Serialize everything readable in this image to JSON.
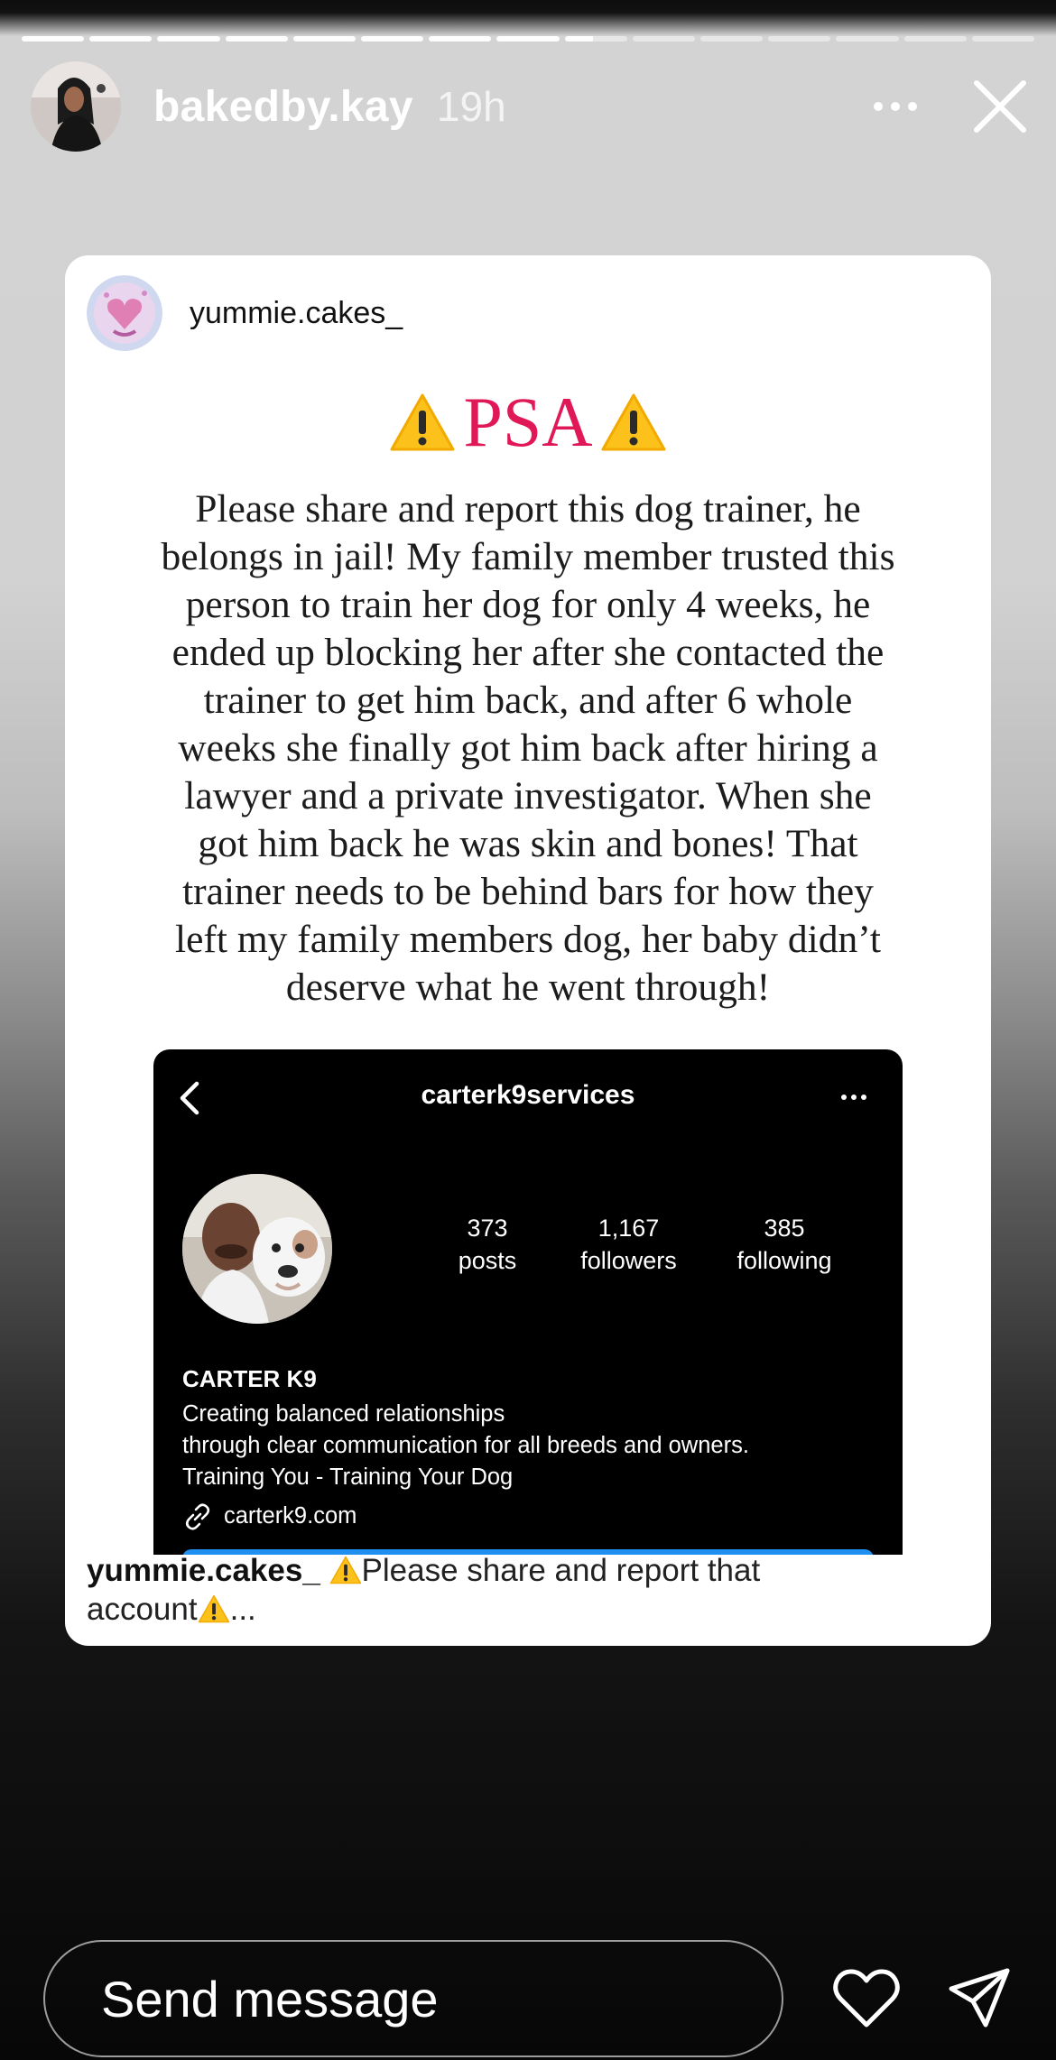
{
  "story": {
    "segments_total": 15,
    "segments_done": 8,
    "current_progress": 0.45
  },
  "header": {
    "username": "bakedby.kay",
    "time": "19h",
    "more_icon": "more-horizontal-icon",
    "close_icon": "close-icon"
  },
  "shared_post": {
    "username": "yummie.cakes_",
    "psa_title": "PSA",
    "psa_color": "#e01858",
    "body_lines": [
      "Please share and report this dog trainer, he",
      "belongs in jail! My family member trusted this",
      "person to train her dog for only 4 weeks, he",
      "ended up blocking her after she contacted the",
      "trainer to get him back, and after 6 whole",
      "weeks she finally got him back after hiring a",
      "lawyer and a private investigator. When she",
      "got him back he was skin and bones! That",
      "trainer needs to be behind bars for how they",
      "left my family members dog, her baby didn’t",
      "deserve what he went through!"
    ],
    "screenshot": {
      "title": "carterk9services",
      "stats": [
        {
          "value": "373",
          "label": "posts"
        },
        {
          "value": "1,167",
          "label": "followers"
        },
        {
          "value": "385",
          "label": "following"
        }
      ],
      "bio_name": "CARTER K9",
      "bio_lines": [
        "Creating balanced relationships",
        "through clear communication for all breeds and owners.",
        "Training You - Training Your Dog"
      ],
      "link": "carterk9.com",
      "button_color": "#1f8ff0"
    },
    "caption": {
      "username": "yummie.cakes_",
      "text_part1": "Please share and report that",
      "text_part2": "account",
      "ellipsis": "..."
    }
  },
  "footer": {
    "message_placeholder": "Send message",
    "like_icon": "heart-icon",
    "share_icon": "send-icon"
  }
}
